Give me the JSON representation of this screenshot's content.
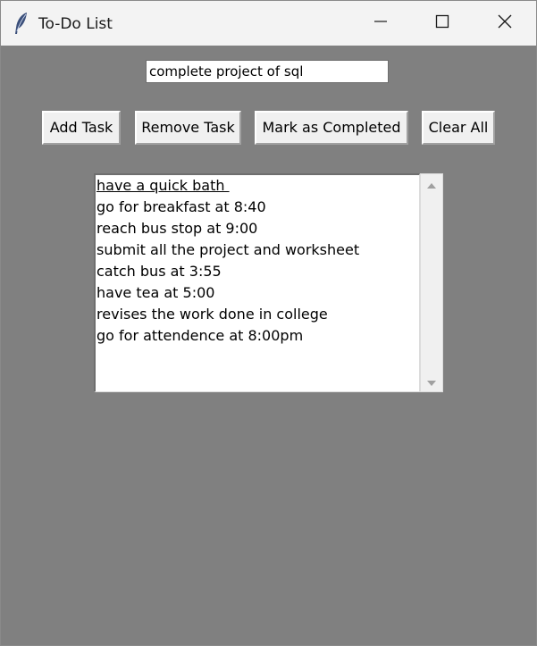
{
  "window": {
    "title": "To-Do List",
    "icon": "feather-icon",
    "controls": {
      "minimize_icon": "minimize-icon",
      "maximize_icon": "maximize-icon",
      "close_icon": "close-icon"
    }
  },
  "task_entry": {
    "value": "complete project of sql"
  },
  "buttons": {
    "add_label": "Add Task",
    "remove_label": "Remove Task",
    "complete_label": "Mark as Completed",
    "clear_label": "Clear All"
  },
  "tasks": [
    "have a quick bath ",
    "go for breakfast at 8:40",
    "reach bus stop at 9:00",
    "submit all the project and worksheet",
    "catch bus at 3:55",
    "have tea at 5:00",
    "revises the work done in college",
    "go for attendence at 8:00pm"
  ],
  "selected_task_index": 0,
  "colors": {
    "background": "#808080",
    "titlebar": "#f3f3f3",
    "button_face": "#f0f0f0"
  }
}
